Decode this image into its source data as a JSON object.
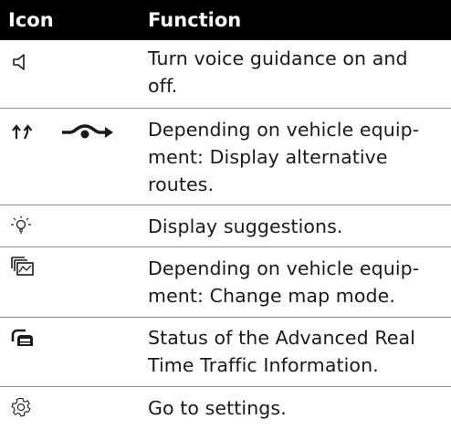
{
  "header": {
    "icon_label": "Icon",
    "function_label": "Function"
  },
  "rows": [
    {
      "icons": [
        "speaker-icon"
      ],
      "lines": [
        "Turn voice guidance on and",
        "off."
      ]
    },
    {
      "icons": [
        "alternative-routes-arrows-icon",
        "route-fork-icon"
      ],
      "lines": [
        "Depending on vehicle equip-",
        "ment: Display alternative",
        "routes."
      ]
    },
    {
      "icons": [
        "lightbulb-icon"
      ],
      "lines": [
        "Display suggestions."
      ]
    },
    {
      "icons": [
        "map-mode-icon"
      ],
      "lines": [
        "Depending on vehicle equip-",
        "ment: Change map mode."
      ]
    },
    {
      "icons": [
        "traffic-info-car-icon"
      ],
      "lines": [
        "Status of the Advanced Real",
        "Time Traffic Information."
      ]
    },
    {
      "icons": [
        "gear-icon"
      ],
      "lines": [
        "Go to settings."
      ]
    }
  ]
}
